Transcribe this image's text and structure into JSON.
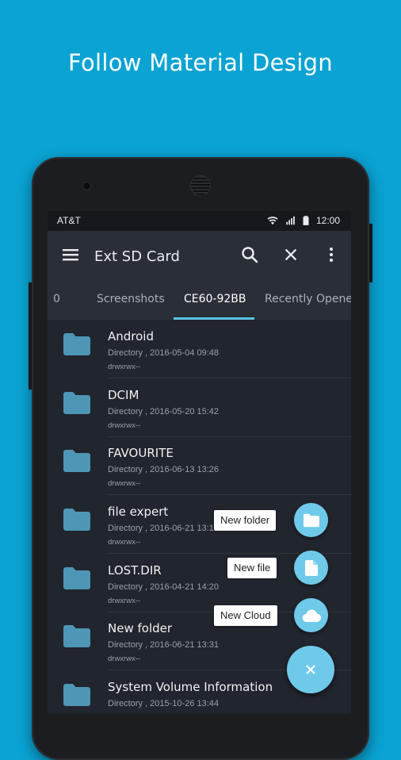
{
  "promo": {
    "headline": "Follow Material Design"
  },
  "colors": {
    "background": "#0aa3d3",
    "accent": "#6fcaea",
    "toolbar": "#2a2e37",
    "folder": "#4e96b5"
  },
  "status_bar": {
    "carrier": "AT&T",
    "time": "12:00",
    "icons": [
      "wifi-icon",
      "signal-icon",
      "battery-icon"
    ]
  },
  "toolbar": {
    "title": "Ext SD Card",
    "icons": [
      "menu-icon",
      "search-icon",
      "close-icon",
      "more-vert-icon"
    ]
  },
  "tabs": [
    {
      "label": "0",
      "active": false
    },
    {
      "label": "Screenshots",
      "active": false
    },
    {
      "label": "CE60-92BB",
      "active": true
    },
    {
      "label": "Recently Opened",
      "active": false
    }
  ],
  "files": [
    {
      "name": "Android",
      "meta": "Directory , 2016-05-04 09:48",
      "perm": "drwxrwx--"
    },
    {
      "name": "DCIM",
      "meta": "Directory , 2016-05-20 15:42",
      "perm": "drwxrwx--"
    },
    {
      "name": "FAVOURITE",
      "meta": "Directory , 2016-06-13 13:26",
      "perm": "drwxrwx--"
    },
    {
      "name": "file expert",
      "meta": "Directory , 2016-06-21 13:10",
      "perm": "drwxrwx--"
    },
    {
      "name": "LOST.DIR",
      "meta": "Directory , 2016-04-21 14:20",
      "perm": "drwxrwx--"
    },
    {
      "name": "New folder",
      "meta": "Directory , 2016-06-21 13:31",
      "perm": "drwxrwx--"
    },
    {
      "name": "System Volume Information",
      "meta": "Directory , 2015-10-26 13:44",
      "perm": ""
    }
  ],
  "fab_menu": {
    "new_folder": "New folder",
    "new_file": "New file",
    "new_cloud": "New Cloud",
    "close_symbol": "×"
  }
}
